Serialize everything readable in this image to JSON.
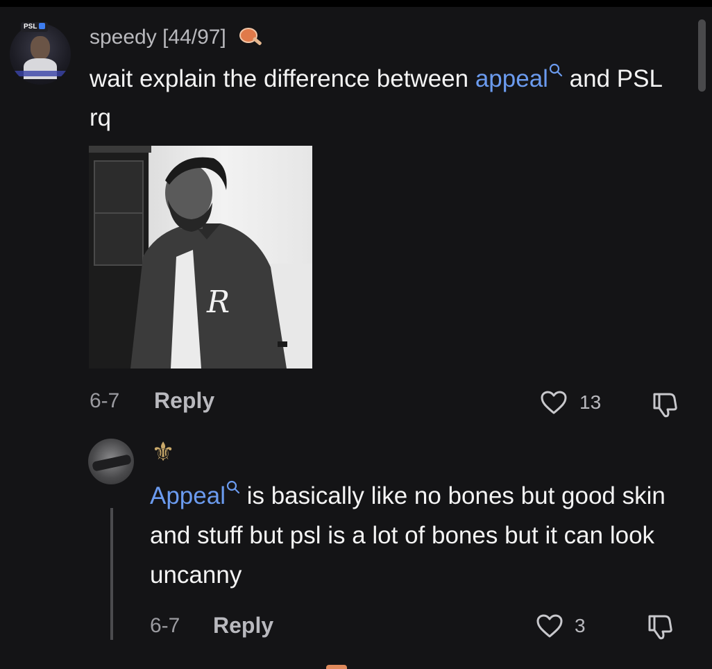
{
  "comment": {
    "username": "speedy [44/97]",
    "avatar_badge": "PSL",
    "text_before_link": "wait explain the difference between ",
    "link_text": "appeal",
    "text_after_link": " and PSL rq",
    "date": "6-7",
    "reply_label": "Reply",
    "like_count": "13",
    "icons": {
      "ping": "ping-pong-icon",
      "search": "search-icon",
      "like": "heart-icon",
      "dislike": "thumbs-down-icon"
    }
  },
  "reply": {
    "badge_glyph": "⚜",
    "link_text": "Appeal",
    "text": " is basically like no bones but good skin and stuff but psl is a lot of bones but it can look uncanny",
    "date": "6-7",
    "reply_label": "Reply",
    "like_count": "3"
  },
  "colors": {
    "background": "#141416",
    "link": "#6b9bef",
    "muted": "#9b9ba0",
    "text": "#f4f4f4"
  }
}
